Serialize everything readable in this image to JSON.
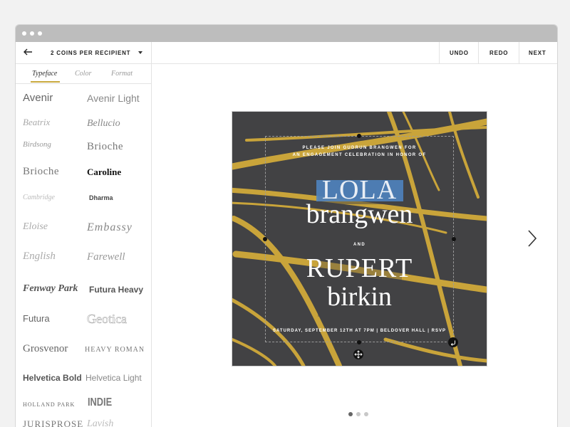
{
  "toolbar": {
    "coins_label": "2 COINS PER RECIPIENT",
    "undo": "UNDO",
    "redo": "REDO",
    "next": "NEXT"
  },
  "sidebar": {
    "tabs": [
      "Typeface",
      "Color",
      "Format"
    ],
    "active_tab": "Typeface",
    "fonts": [
      "Avenir",
      "Avenir Light",
      "Beatrix",
      "Bellucio",
      "Birdsong",
      "Brioche",
      "Brioche",
      "Caroline",
      "Cambridge",
      "Dharma",
      "Eloise",
      "Embassy",
      "English",
      "Farewell",
      "Fenway Park",
      "Futura Heavy",
      "Futura",
      "Geotica",
      "Grosvenor",
      "Heavy Roman",
      "Helvetica Bold",
      "Helvetica Light",
      "Holland Park",
      "INDIE",
      "Jurisprose",
      "Lavish"
    ]
  },
  "card": {
    "intro_line1": "PLEASE JOIN GUDRUN BRANGWEN FOR",
    "intro_line2": "AN ENGAGEMENT CELEBRATION IN HONOR OF",
    "name1_first": "LOLA",
    "name1_last": "brangwen",
    "conjunction": "AND",
    "name2_first": "RUPERT",
    "name2_last": "birkin",
    "details": "SATURDAY, SEPTEMBER 12TH AT 7PM | BELDOVER HALL | RSVP",
    "colors": {
      "background": "#424244",
      "gold": "#c9a43a",
      "highlight": "#4f86c6"
    }
  },
  "pager": {
    "pages": 3,
    "current": 1
  }
}
